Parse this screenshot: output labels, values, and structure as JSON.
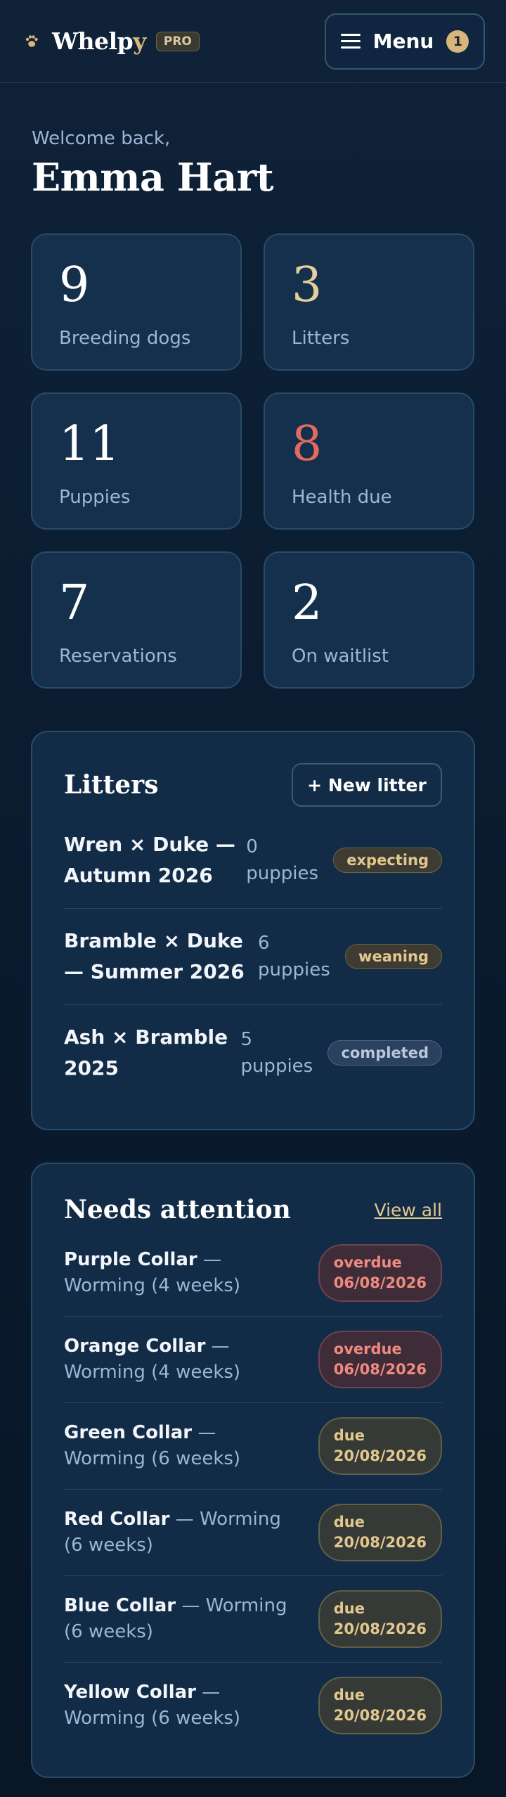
{
  "header": {
    "brand_main": "Whelp",
    "brand_accent": "y",
    "plan_badge": "PRO",
    "menu_label": "Menu",
    "menu_count": "1",
    "icon": "paw-icon"
  },
  "welcome": {
    "greeting": "Welcome back,",
    "name": "Emma Hart"
  },
  "stats": [
    {
      "value": "9",
      "label": "Breeding dogs"
    },
    {
      "value": "3",
      "label": "Litters"
    },
    {
      "value": "11",
      "label": "Puppies"
    },
    {
      "value": "8",
      "label": "Health due"
    },
    {
      "value": "7",
      "label": "Reservations"
    },
    {
      "value": "2",
      "label": "On waitlist"
    }
  ],
  "litters": {
    "title": "Litters",
    "new_button": "+ New litter",
    "items": [
      {
        "name": "Wren × Duke — Autumn 2026",
        "puppies": "0 puppies",
        "status": "expecting"
      },
      {
        "name": "Bramble × Duke — Summer 2026",
        "puppies": "6 puppies",
        "status": "weaning"
      },
      {
        "name": "Ash × Bramble 2025",
        "puppies": "5 puppies",
        "status": "completed"
      }
    ]
  },
  "attention": {
    "title": "Needs attention",
    "view_all": "View all",
    "items": [
      {
        "puppy": "Purple Collar",
        "task": " — Worming (4 weeks)",
        "status": "overdue",
        "date": "06/08/2026"
      },
      {
        "puppy": "Orange Collar",
        "task": " — Worming (4 weeks)",
        "status": "overdue",
        "date": "06/08/2026"
      },
      {
        "puppy": "Green Collar",
        "task": " — Worming (6 weeks)",
        "status": "due",
        "date": "20/08/2026"
      },
      {
        "puppy": "Red Collar",
        "task": " — Worming (6 weeks)",
        "status": "due",
        "date": "20/08/2026"
      },
      {
        "puppy": "Blue Collar",
        "task": " — Worming (6 weeks)",
        "status": "due",
        "date": "20/08/2026"
      },
      {
        "puppy": "Yellow Collar",
        "task": " — Worming (6 weeks)",
        "status": "due",
        "date": "20/08/2026"
      }
    ]
  },
  "colors": {
    "accent_gold": "#d7b67c",
    "health_red": "#e26a5f",
    "background": "#0f2238"
  }
}
